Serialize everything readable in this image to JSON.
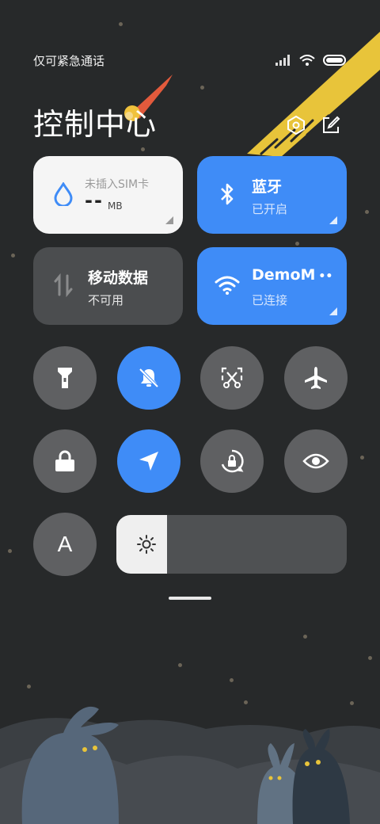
{
  "status_bar": {
    "carrier_text": "仅可紧急通话",
    "icons": [
      "signal-icon",
      "wifi-icon",
      "battery-icon"
    ]
  },
  "header": {
    "title": "控制中心",
    "icons": [
      "settings-icon",
      "edit-icon"
    ]
  },
  "cards": {
    "data_usage": {
      "title": "未插入SIM卡",
      "value": "--",
      "unit": "MB"
    },
    "bluetooth": {
      "title": "蓝牙",
      "status": "已开启"
    },
    "mobile_data": {
      "title": "移动数据",
      "status": "不可用"
    },
    "wifi": {
      "title": "DemoM",
      "status": "已连接"
    }
  },
  "toggles": [
    {
      "name": "flashlight-icon",
      "on": false
    },
    {
      "name": "mute-bell-icon",
      "on": true
    },
    {
      "name": "screenshot-icon",
      "on": false
    },
    {
      "name": "airplane-icon",
      "on": false
    },
    {
      "name": "lock-icon",
      "on": false
    },
    {
      "name": "location-icon",
      "on": true
    },
    {
      "name": "rotation-lock-icon",
      "on": false
    },
    {
      "name": "eye-icon",
      "on": false
    },
    {
      "name": "font-a-icon",
      "on": false
    }
  ],
  "font_toggle_label": "A",
  "brightness": {
    "level": 0.22
  },
  "colors": {
    "background": "#27292a",
    "active_blue": "#3f8cf7",
    "inactive_gray": "#5f6062",
    "meteor_yellow": "#e8c43a"
  }
}
